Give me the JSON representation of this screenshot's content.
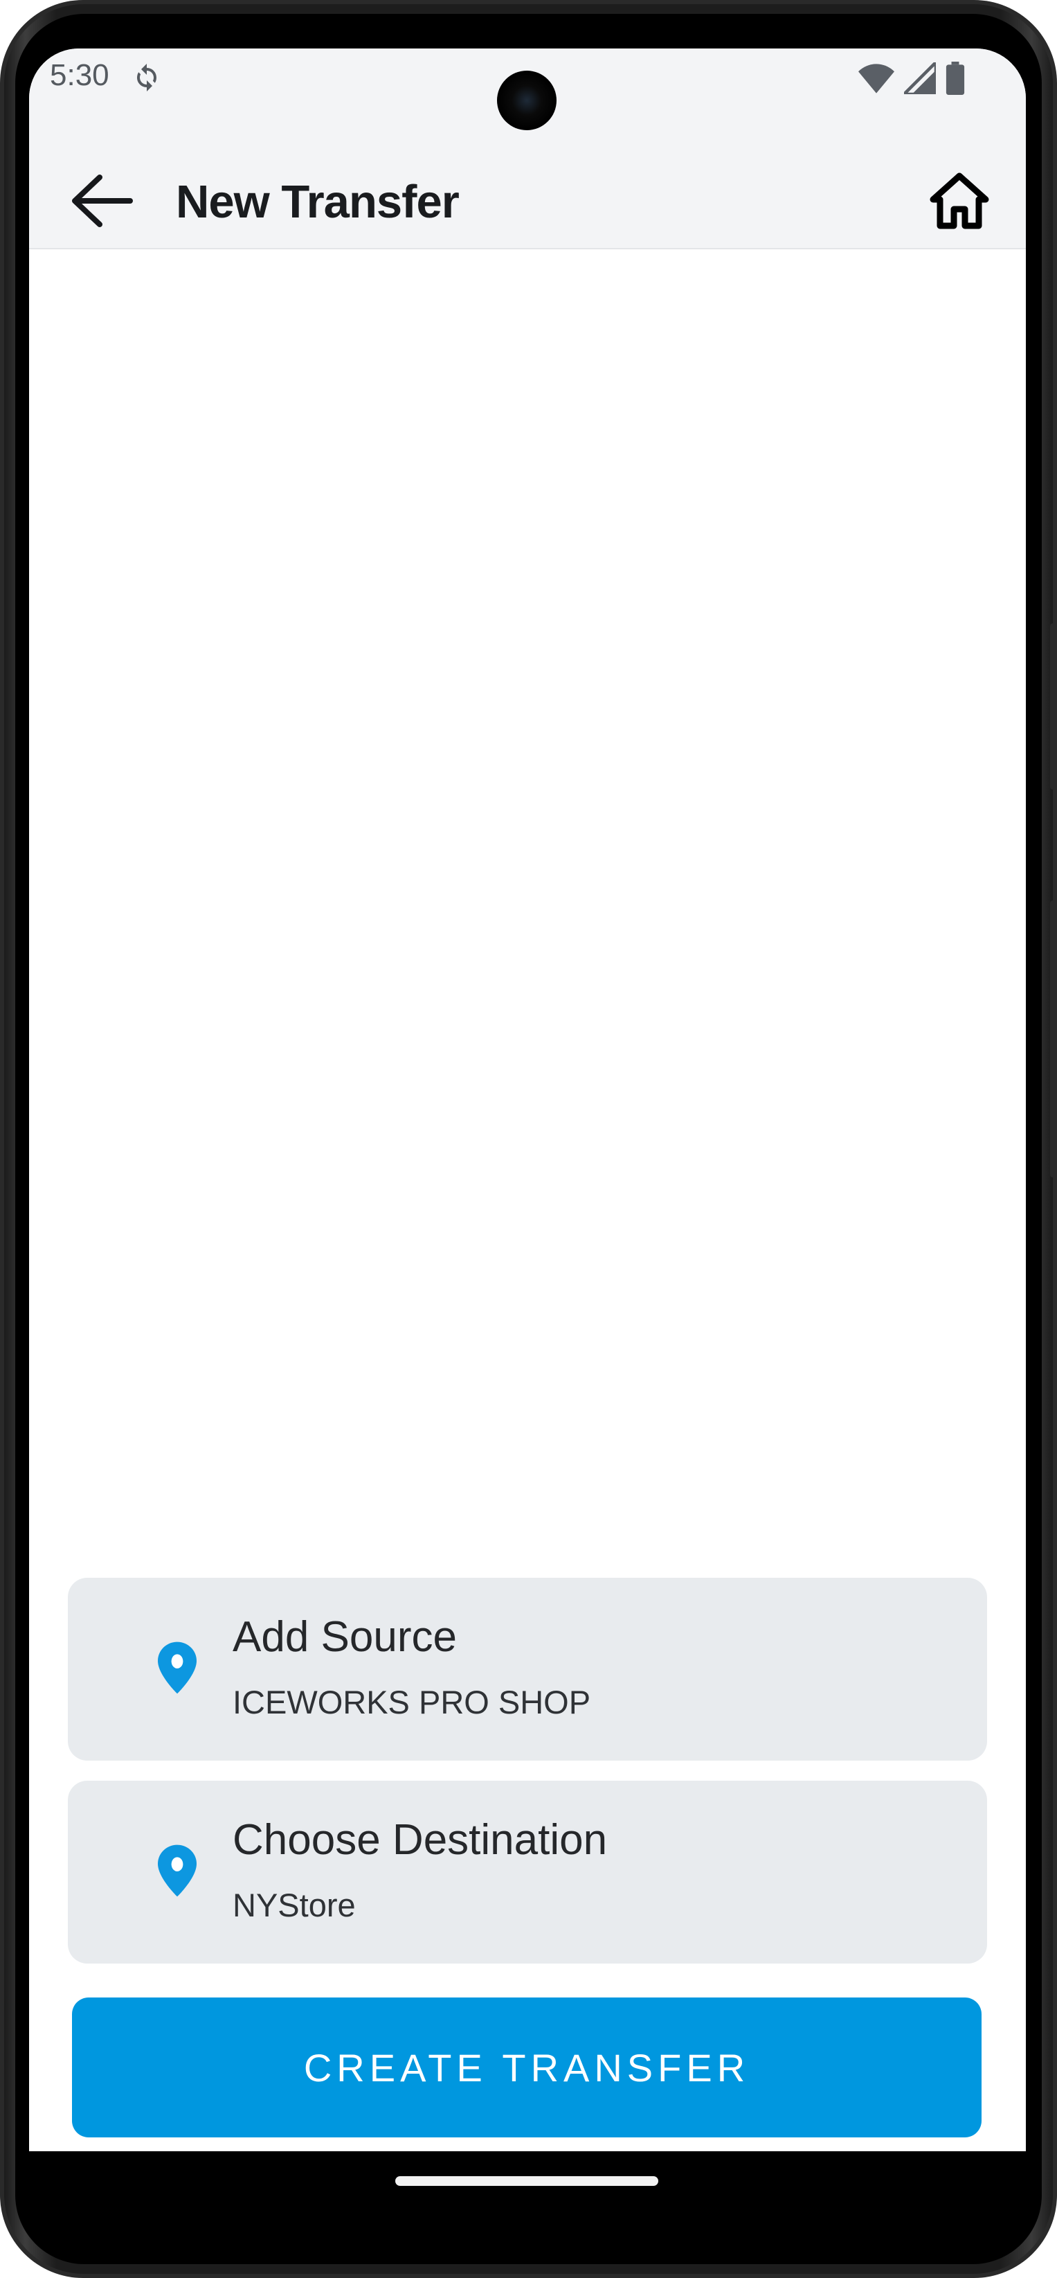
{
  "status_bar": {
    "time": "5:30",
    "icons": [
      "sync-icon",
      "wifi-icon",
      "signal-icon",
      "battery-icon"
    ]
  },
  "app_bar": {
    "back_icon": "arrow-left-icon",
    "title": "New Transfer",
    "home_icon": "home-icon"
  },
  "source": {
    "icon": "location-pin-icon",
    "label": "Add Source",
    "value": "ICEWORKS PRO SHOP"
  },
  "destination": {
    "icon": "location-pin-icon",
    "label": "Choose Destination",
    "value": "NYStore"
  },
  "create_button": {
    "label": "CREATE TRANSFER"
  },
  "colors": {
    "accent": "#0097df",
    "app_bar_bg": "#f3f4f6",
    "card_bg": "#e8ebee",
    "text_primary": "#1a1c1f"
  }
}
